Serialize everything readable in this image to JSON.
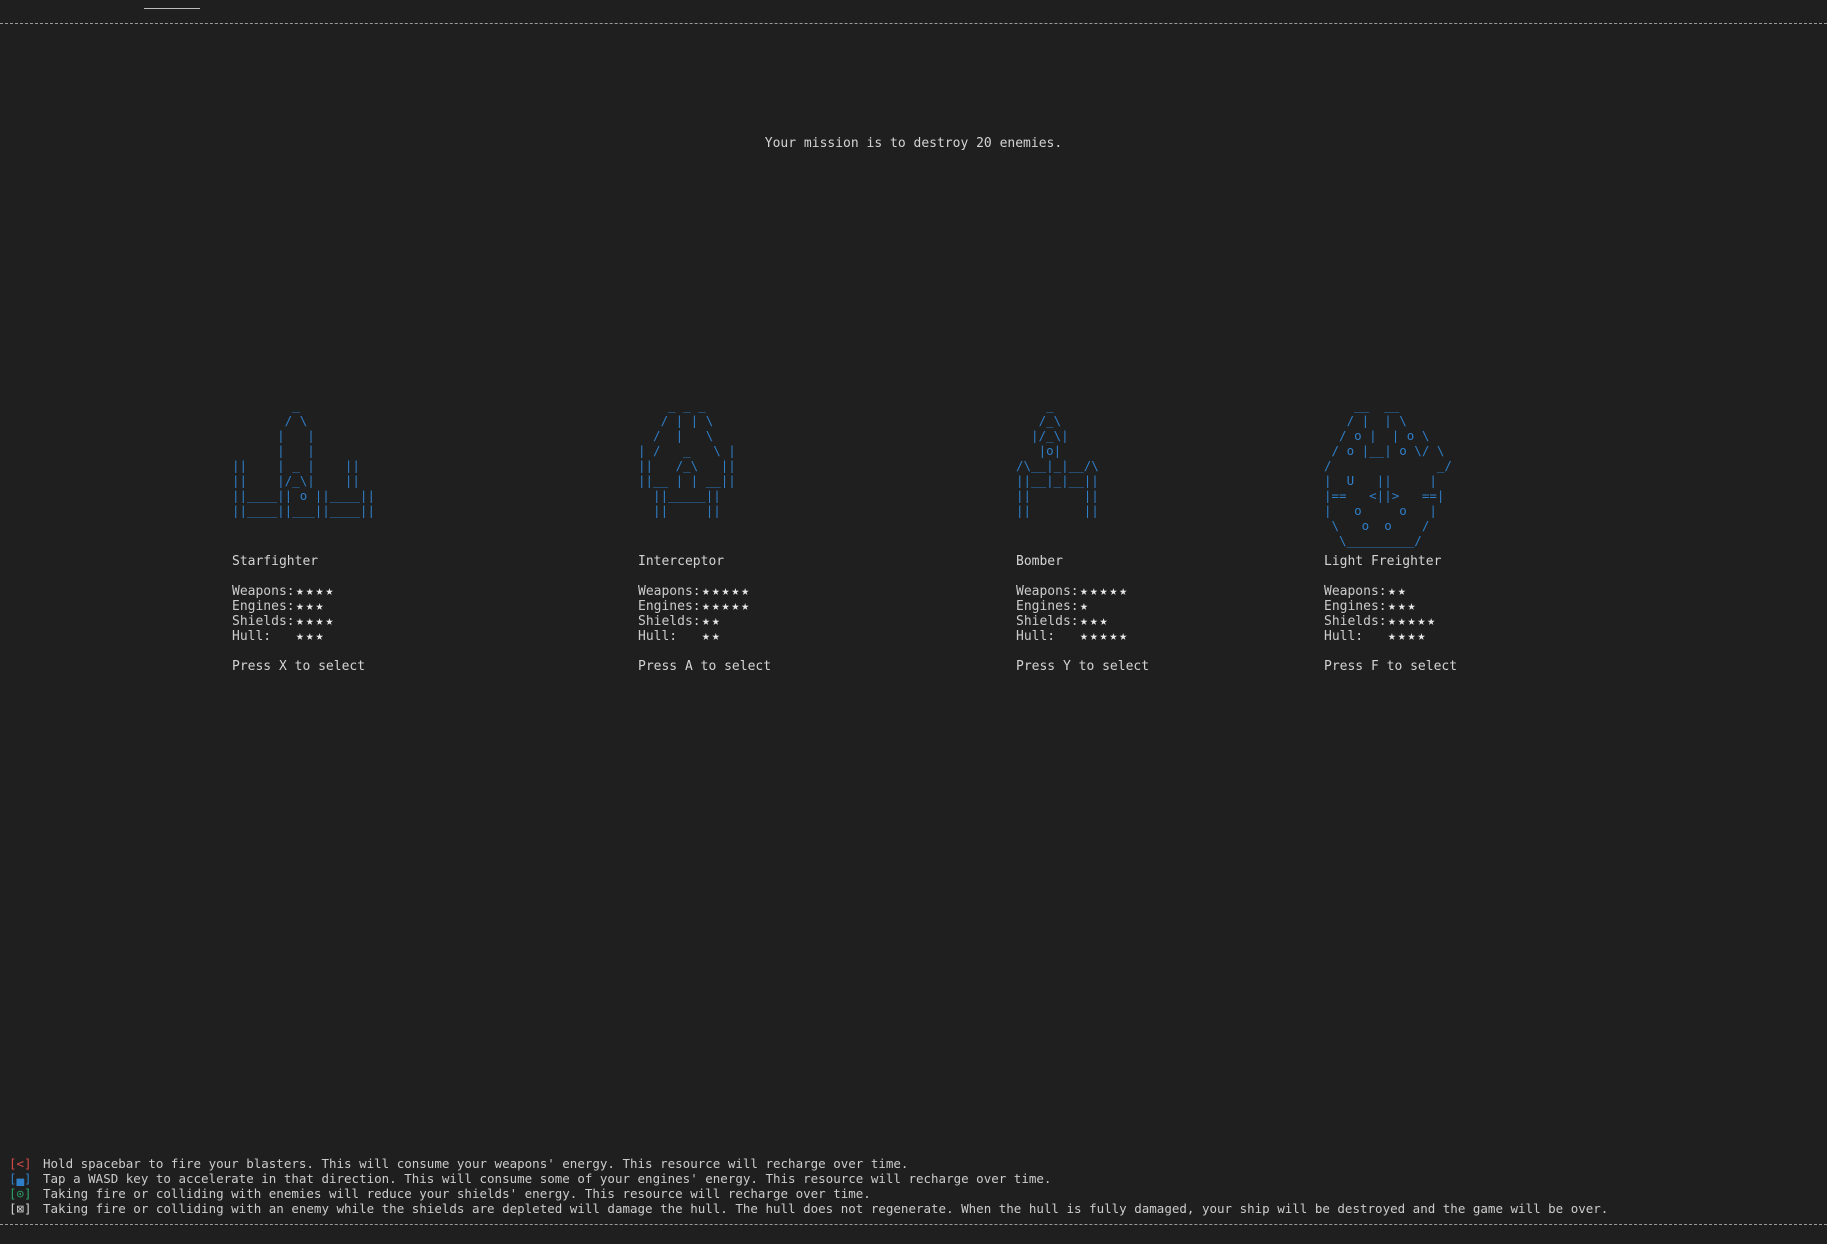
{
  "mission_text": "Your mission is to destroy 20 enemies.",
  "stat_labels": {
    "weapons": "Weapons:",
    "engines": "Engines:",
    "shields": "Shields:",
    "hull": "Hull:"
  },
  "ships": [
    {
      "name": "Starfighter",
      "art": "        _\n       / \\\n      |   |\n      |   |\n||    | _ |    ||\n||    |/_\\|    ||\n||____|| o ||____||\n||____||___||____||",
      "weapons": "★★★★",
      "engines": "★★★",
      "shields": "★★★★",
      "hull": "★★★",
      "select": "Press X to select"
    },
    {
      "name": "Interceptor",
      "art": "    _ _ _\n   / | | \\\n  /  |   \\\n| /   _   \\ |\n||   /_\\   ||\n||__ | | __||\n  ||_____||\n  ||     ||",
      "weapons": "★★★★★",
      "engines": "★★★★★",
      "shields": "★★",
      "hull": "★★",
      "select": "Press A to select"
    },
    {
      "name": "Bomber",
      "art": "    _\n   /_\\\n  |/_\\|\n   |o|\n/\\__|_|__/\\\n||__|_|__||\n||       ||\n||       ||",
      "weapons": "★★★★★",
      "engines": "★",
      "shields": "★★★",
      "hull": "★★★★★",
      "select": "Press Y to select"
    },
    {
      "name": "Light Freighter",
      "art": "    __  __\n   / |  | \\\n  / o |  | o \\\n / o |__| o \\/ \\\n/              _/\n|  U   ||     |\n|==   <||>   ==|\n|   o     o   |\n \\   o  o    /\n  \\_________/",
      "weapons": "★★",
      "engines": "★★★",
      "shields": "★★★★★",
      "hull": "★★★★",
      "select": "Press F to select"
    }
  ],
  "legend": [
    {
      "icon": "[<]",
      "text": "Hold spacebar to fire your blasters. This will consume your weapons' energy. This resource will recharge over time."
    },
    {
      "icon": "[▄]",
      "text": "Tap a WASD key to accelerate in that direction. This will consume some of your engines' energy. This resource will recharge over time."
    },
    {
      "icon": "[⊙]",
      "text": "Taking fire or colliding with enemies will reduce your shields' energy. This resource will recharge over time."
    },
    {
      "icon": "[⊠]",
      "text": "Taking fire or colliding with an enemy while the shields are depleted will damage the hull. The hull does not regenerate. When the hull is fully damaged, your ship will be destroyed and the game will be over."
    }
  ]
}
